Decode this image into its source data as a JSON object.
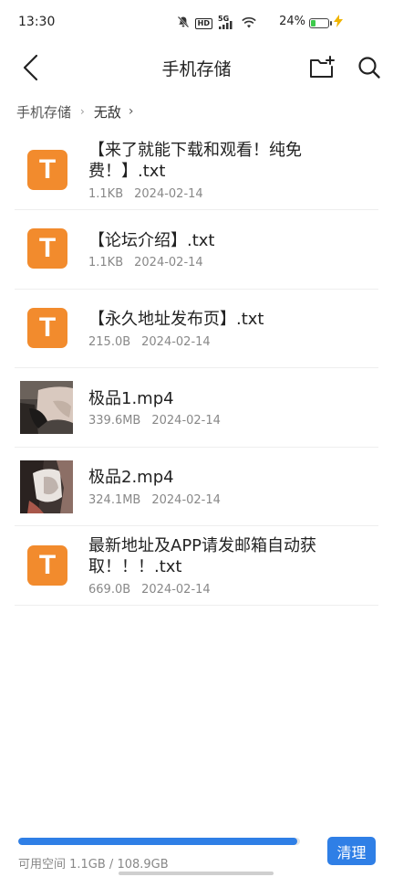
{
  "status_bar": {
    "time": "13:30",
    "hd_label": "HD",
    "network_label": "5G",
    "battery_percent": "24%",
    "battery_level": 0.24,
    "icons": [
      "mute-icon",
      "hd-icon",
      "signal-icon",
      "wifi-icon",
      "battery-icon",
      "charging-icon"
    ]
  },
  "header": {
    "title": "手机存储",
    "icons": [
      "back-icon",
      "new-folder-icon",
      "search-icon"
    ]
  },
  "breadcrumb": {
    "root": "手机存储",
    "current": "无敌"
  },
  "files": [
    {
      "type": "txt",
      "icon_letter": "T",
      "name": "【来了就能下载和观看！纯免费！】.txt",
      "size": "1.1KB",
      "date": "2024-02-14"
    },
    {
      "type": "txt",
      "icon_letter": "T",
      "name": "【论坛介绍】.txt",
      "size": "1.1KB",
      "date": "2024-02-14"
    },
    {
      "type": "txt",
      "icon_letter": "T",
      "name": "【永久地址发布页】.txt",
      "size": "215.0B",
      "date": "2024-02-14"
    },
    {
      "type": "video",
      "name": "极品1.mp4",
      "size": "339.6MB",
      "date": "2024-02-14"
    },
    {
      "type": "video",
      "name": "极品2.mp4",
      "size": "324.1MB",
      "date": "2024-02-14"
    },
    {
      "type": "txt",
      "icon_letter": "T",
      "name": "最新地址及APP请发邮箱自动获取！！！.txt",
      "size": "669.0B",
      "date": "2024-02-14"
    }
  ],
  "footer": {
    "storage_text": "可用空间 1.1GB / 108.9GB",
    "used_fraction": 0.99,
    "clean_label": "清理"
  },
  "colors": {
    "accent": "#2f7fe6",
    "txt_icon": "#f28b2d",
    "battery": "#3dc94b"
  }
}
